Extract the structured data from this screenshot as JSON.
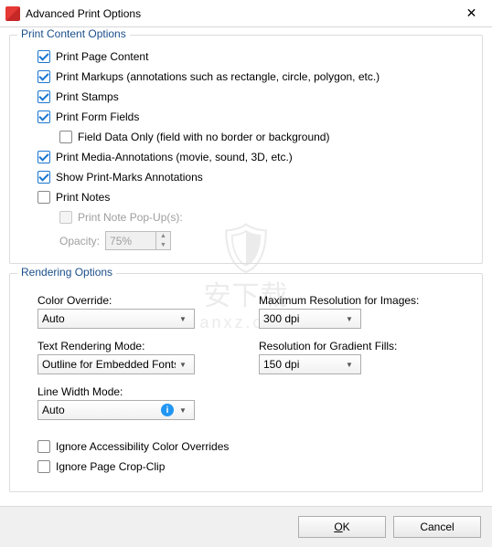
{
  "window": {
    "title": "Advanced Print Options"
  },
  "group1": {
    "legend": "Print Content Options",
    "c1": {
      "label": "Print Page Content",
      "checked": true
    },
    "c2": {
      "label": "Print Markups (annotations such as rectangle, circle, polygon, etc.)",
      "checked": true
    },
    "c3": {
      "label": "Print Stamps",
      "checked": true
    },
    "c4": {
      "label": "Print Form Fields",
      "checked": true
    },
    "c4a": {
      "label": "Field Data Only (field with no border or background)",
      "checked": false
    },
    "c5": {
      "label": "Print Media-Annotations (movie, sound, 3D, etc.)",
      "checked": true
    },
    "c6": {
      "label": "Show Print-Marks Annotations",
      "checked": true
    },
    "c7": {
      "label": "Print Notes",
      "checked": false
    },
    "c7a": {
      "label": "Print Note Pop-Up(s):",
      "disabled": true
    },
    "opacity": {
      "label": "Opacity:",
      "value": "75%"
    }
  },
  "group2": {
    "legend": "Rendering Options",
    "colorOverride": {
      "label": "Color Override:",
      "value": "Auto"
    },
    "maxRes": {
      "label": "Maximum Resolution for Images:",
      "value": "300 dpi"
    },
    "textRender": {
      "label": "Text Rendering Mode:",
      "value": "Outline for Embedded Fonts"
    },
    "gradRes": {
      "label": "Resolution for Gradient Fills:",
      "value": "150 dpi"
    },
    "lineWidth": {
      "label": "Line Width Mode:",
      "value": "Auto"
    },
    "ign1": {
      "label": "Ignore Accessibility Color Overrides",
      "checked": false
    },
    "ign2": {
      "label": "Ignore Page Crop-Clip",
      "checked": false
    }
  },
  "footer": {
    "ok_u": "O",
    "ok_rest": "K",
    "cancel": "Cancel"
  },
  "watermark": {
    "main": "安下载",
    "sub": "anxz.com"
  }
}
